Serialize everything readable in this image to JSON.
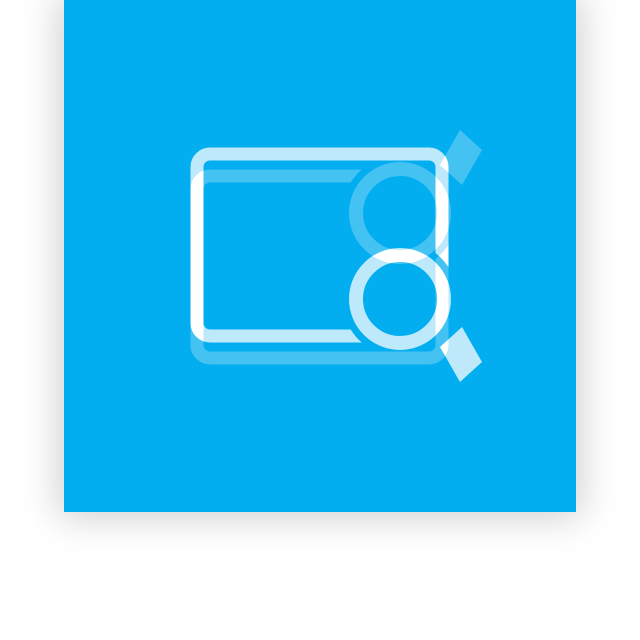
{
  "tile": {
    "icon": "screen-zoom-icon",
    "background_color": "#03aef0",
    "icon_color": "#ffffff"
  }
}
